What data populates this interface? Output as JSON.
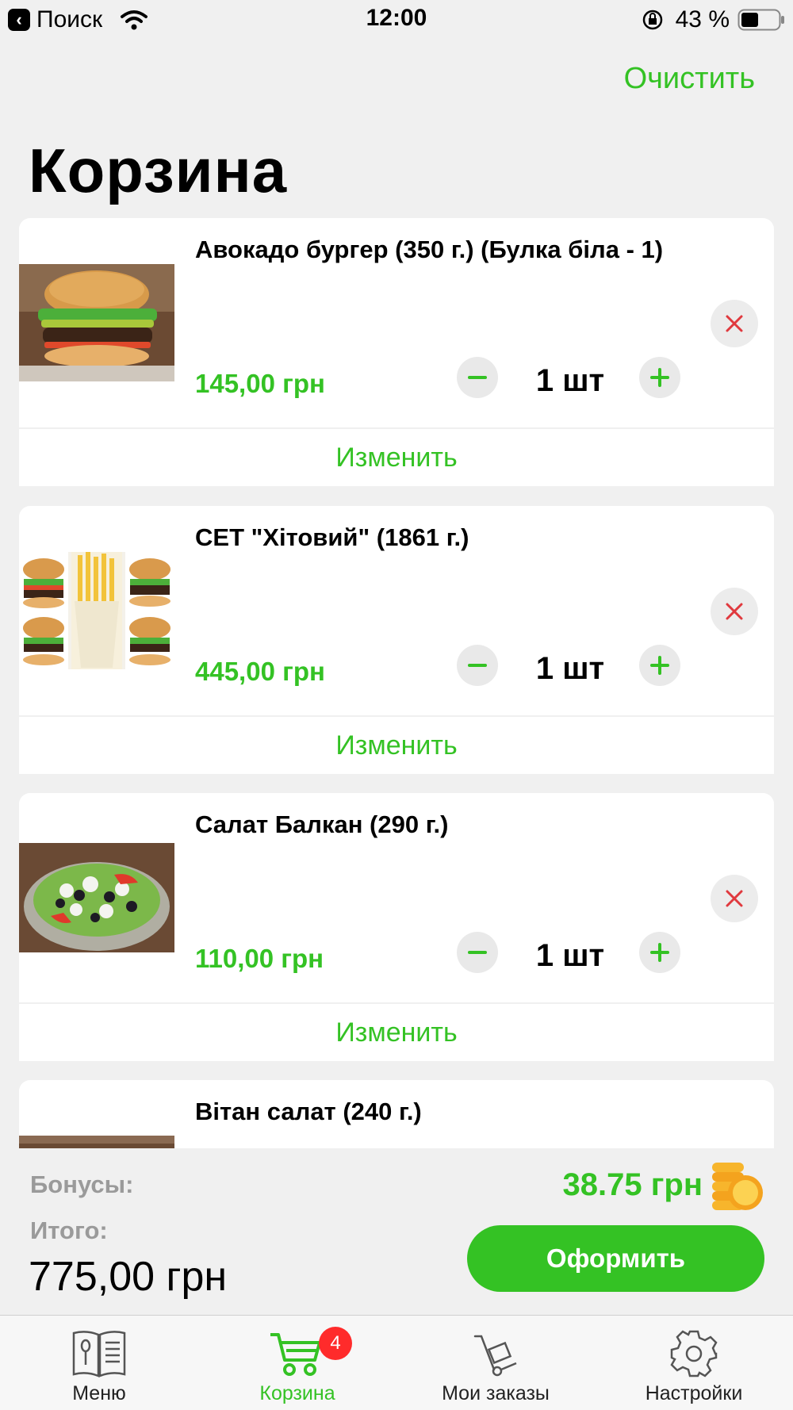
{
  "status_bar": {
    "back_label": "Поиск",
    "time": "12:00",
    "battery": "43 %"
  },
  "header": {
    "clear_label": "Очистить",
    "title": "Корзина"
  },
  "cart": {
    "edit_label": "Изменить",
    "items": [
      {
        "name": "Авокадо бургер (350 г.) (Булка біла - 1)",
        "price": "145,00 грн",
        "qty": "1 шт",
        "image": "burger-photo"
      },
      {
        "name": "СЕТ \"Хітовий\" (1861 г.)",
        "price": "445,00 грн",
        "qty": "1 шт",
        "image": "burger-set-photo"
      },
      {
        "name": "Салат Балкан (290 г.)",
        "price": "110,00 грн",
        "qty": "1 шт",
        "image": "salad-photo"
      },
      {
        "name": "Вітан салат (240 г.)",
        "image": "salad-photo"
      }
    ]
  },
  "summary": {
    "bonus_label": "Бонусы:",
    "bonus_value": "38.75 грн",
    "total_label": "Итого:",
    "total_value": "775,00 грн",
    "checkout_label": "Оформить"
  },
  "tabs": [
    {
      "label": "Меню",
      "icon": "menu-book-icon",
      "active": false
    },
    {
      "label": "Корзина",
      "icon": "cart-icon",
      "active": true,
      "badge": "4"
    },
    {
      "label": "Мои заказы",
      "icon": "hand-truck-icon",
      "active": false
    },
    {
      "label": "Настройки",
      "icon": "gear-icon",
      "active": false
    }
  ],
  "colors": {
    "accent": "#34c224",
    "badge": "#ff2b2b",
    "remove": "#e0393e"
  }
}
